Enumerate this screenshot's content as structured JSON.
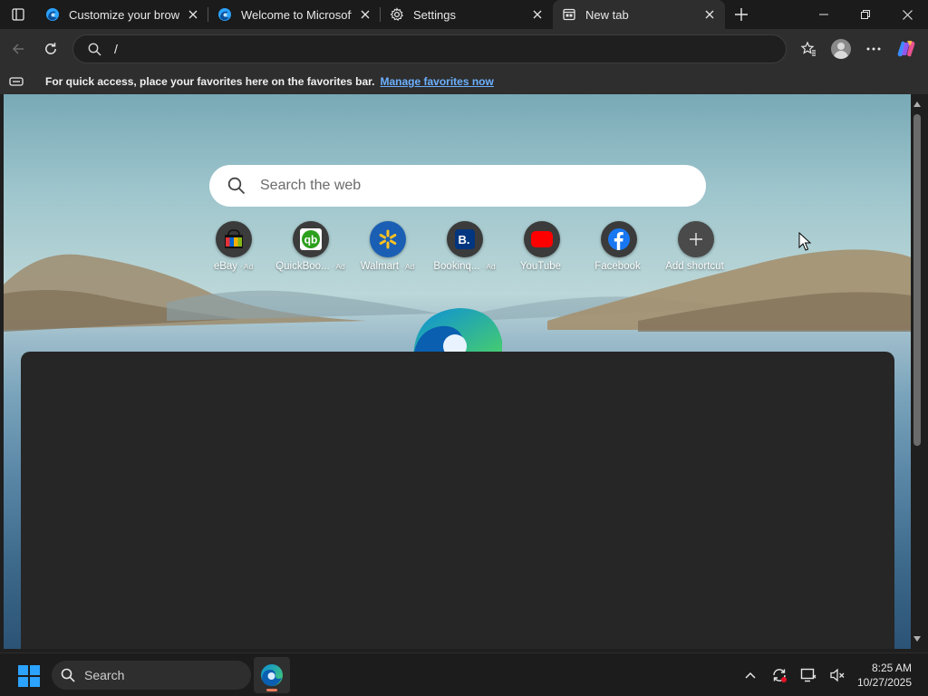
{
  "window": {
    "tabs": [
      {
        "title": "Customize your browser",
        "icon": "edge-icon",
        "active": false
      },
      {
        "title": "Welcome to Microsoft E",
        "icon": "edge-icon",
        "active": false
      },
      {
        "title": "Settings",
        "icon": "gear-icon",
        "active": false
      },
      {
        "title": "New tab",
        "icon": "newtab-icon",
        "active": true
      }
    ],
    "controls": [
      "minimize",
      "restore",
      "close"
    ]
  },
  "toolbar": {
    "address_value": "/",
    "buttons": [
      "back",
      "refresh",
      "favorites",
      "profile",
      "settings-and-more",
      "copilot"
    ]
  },
  "favorites_bar": {
    "message": "For quick access, place your favorites here on the favorites bar.",
    "link": "Manage favorites now"
  },
  "newtab": {
    "search_placeholder": "Search the web",
    "shortcuts": [
      {
        "label": "eBay",
        "ad": "Ad",
        "icon": "ebay-bag-icon"
      },
      {
        "label": "QuickBoo...",
        "ad": "Ad",
        "icon": "quickbooks-icon"
      },
      {
        "label": "Walmart",
        "ad": "Ad",
        "icon": "walmart-spark-icon"
      },
      {
        "label": "Bookinq...",
        "ad": "Ad",
        "icon": "booking-icon"
      },
      {
        "label": "YouTube",
        "ad": "",
        "icon": "youtube-icon"
      },
      {
        "label": "Facebook",
        "ad": "",
        "icon": "facebook-icon"
      },
      {
        "label": "Add shortcut",
        "ad": "",
        "icon": "plus-icon"
      }
    ]
  },
  "taskbar": {
    "search_label": "Search",
    "time": "8:25 AM",
    "date": "10/27/2025"
  },
  "colors": {
    "accent_link": "#6cb0ff",
    "taskbar_indicator": "#e87a5a",
    "windows_blue": "#2ba3ff"
  }
}
